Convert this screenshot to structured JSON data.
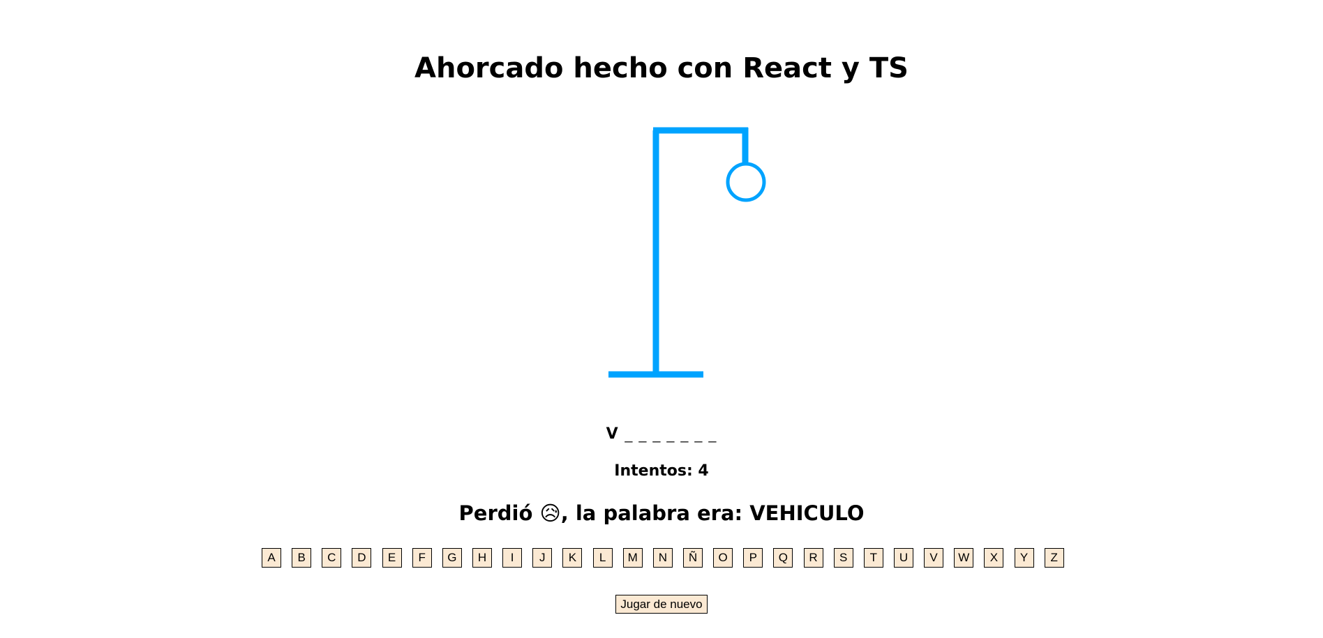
{
  "title": "Ahorcado hecho con React y TS",
  "hangman": {
    "color": "#00a3ff",
    "wrong_guesses_shown": 1
  },
  "word": {
    "revealed": "V",
    "blanks": "_ _ _ _ _ _ _"
  },
  "attempts_text": "Intentos: 4",
  "result": {
    "prefix": "Perdió",
    "emoji": "😥",
    "suffix": ", la palabra era: VEHICULO"
  },
  "keyboard": {
    "letters": [
      "A",
      "B",
      "C",
      "D",
      "E",
      "F",
      "G",
      "H",
      "I",
      "J",
      "K",
      "L",
      "M",
      "N",
      "Ñ",
      "O",
      "P",
      "Q",
      "R",
      "S",
      "T",
      "U",
      "V",
      "W",
      "X",
      "Y",
      "Z"
    ]
  },
  "replay_label": "Jugar de nuevo",
  "colors": {
    "key_background": "#fbe9d3",
    "accent": "#00a3ff"
  }
}
